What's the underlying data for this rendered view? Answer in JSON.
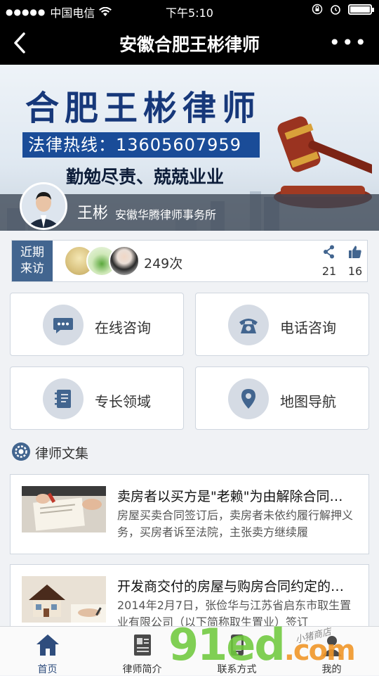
{
  "status_bar": {
    "carrier": "中国电信",
    "time": "下午5:10"
  },
  "nav": {
    "title": "安徽合肥王彬律师"
  },
  "banner": {
    "brand": "合肥王彬律师",
    "hotline": "法律热线：13605607959",
    "slogan": "勤勉尽责、兢兢业业",
    "lawyer_name": "王彬",
    "firm": "安徽华腾律师事务所"
  },
  "visitors": {
    "label_line1": "近期",
    "label_line2": "来访",
    "count": "249次",
    "shares": "21",
    "likes": "16"
  },
  "actions": {
    "online": "在线咨询",
    "phone": "电话咨询",
    "expertise": "专长领域",
    "map": "地图导航"
  },
  "section": {
    "title": "律师文集"
  },
  "articles": [
    {
      "title": "卖房者以买方是\"老赖\"为由解除合同…",
      "summary": "房屋买卖合同签订后，卖房者未依约履行解押义务，买房者诉至法院，主张卖方继续履"
    },
    {
      "title": "开发商交付的房屋与购房合同约定的…",
      "summary": "2014年2月7日，张俭华与江苏省启东市取生置业有限公司（以下简称取生置业）签订"
    }
  ],
  "tabs": [
    {
      "label": "首页"
    },
    {
      "label": "律师简介"
    },
    {
      "label": "联系方式"
    },
    {
      "label": "我的"
    }
  ],
  "watermark": {
    "main": "91ed",
    "suffix": ".com",
    "small": "小猪商店"
  },
  "colors": {
    "accent": "#42658f",
    "tab_active": "#2f4d7d",
    "hotline_bg": "#1a4c98"
  }
}
